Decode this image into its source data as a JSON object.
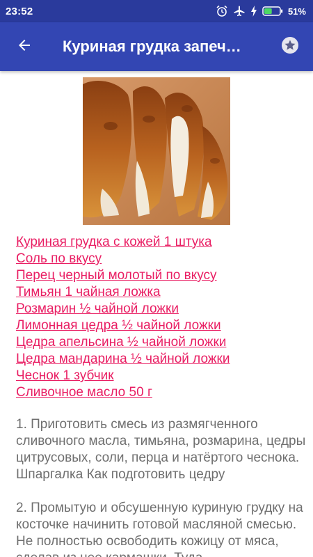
{
  "status_bar": {
    "time": "23:52",
    "battery_percent": "51%",
    "battery_level": 0.51,
    "icons": [
      "alarm-icon",
      "airplane-mode-icon",
      "charging-icon",
      "battery-icon"
    ]
  },
  "app_bar": {
    "title": "Куриная грудка запеч…",
    "back_icon": "arrow-back-icon",
    "favorite_icon": "star-icon",
    "color": "#3346b3"
  },
  "colors": {
    "status_bar": "#2a3a9c",
    "link": "#e91e63",
    "body_text": "#6f6f6f"
  },
  "recipe": {
    "photo_alt": "photo-of-baked-chicken-breast",
    "ingredients": [
      "Куриная грудка с кожей 1 штука",
      "Соль по вкусу",
      "Перец черный молотый по вкусу",
      "Тимьян 1 чайная ложка",
      "Розмарин ½ чайной ложки",
      "Лимонная цедра ½ чайной ложки",
      "Цедра апельсина ½ чайной ложки",
      "Цедра мандарина ½ чайной ложки",
      "Чеснок 1 зубчик",
      "Сливочное масло 50 г"
    ],
    "steps": [
      "1. Приготовить смесь из размягченного сливочного масла, тимьяна, розмарина, цедры цитрусовых, соли, перца и натёртого чеснока. Шпаргалка Как подготовить цедру",
      "2. Промытую и обсушенную куриную грудку на косточке начинить готовой масляной смесью. Не полностью освободить кожицу от мяса, сделав из нее кармашки. Туда"
    ]
  }
}
